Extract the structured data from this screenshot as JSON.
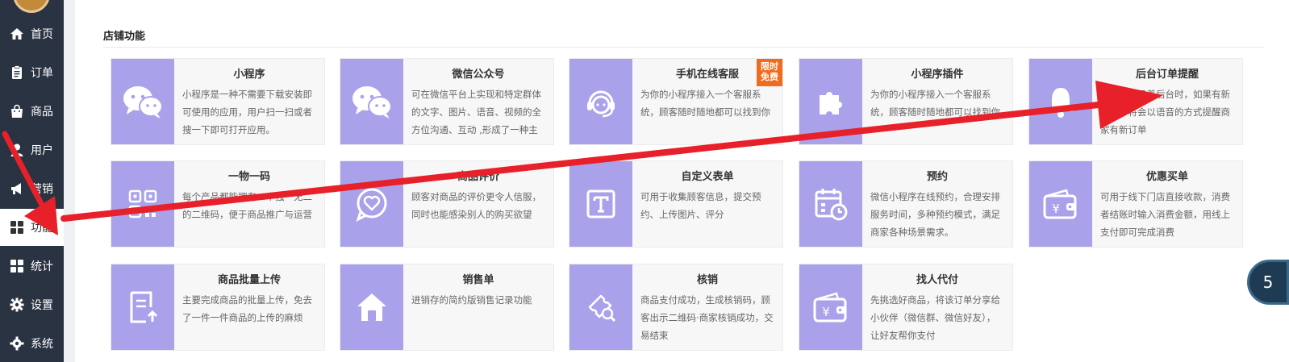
{
  "sidebar": {
    "items": [
      {
        "label": "首页",
        "icon": "home-icon"
      },
      {
        "label": "订单",
        "icon": "clipboard-icon"
      },
      {
        "label": "商品",
        "icon": "shopping-bag-icon"
      },
      {
        "label": "用户",
        "icon": "user-icon"
      },
      {
        "label": "营销",
        "icon": "megaphone-icon"
      },
      {
        "label": "功能",
        "icon": "grid-icon"
      },
      {
        "label": "统计",
        "icon": "grid-icon"
      },
      {
        "label": "设置",
        "icon": "gear-icon"
      },
      {
        "label": "系统",
        "icon": "gear-icon"
      }
    ],
    "active_label": "功能"
  },
  "section": {
    "title": "店铺功能"
  },
  "cards": [
    {
      "title": "小程序",
      "desc": "小程序是一种不需要下载安装即可使用的应用，用户扫一扫或者搜一下即可打开应用。",
      "icon": "chat-bubbles-icon"
    },
    {
      "title": "微信公众号",
      "desc": "可在微信平台上实现和特定群体的文字、图片、语音、视频的全方位沟通、互动 ,形成了一种主",
      "icon": "chat-bubbles-icon"
    },
    {
      "title": "手机在线客服",
      "desc": "为你的小程序接入一个客服系统，顾客随时随地都可以找到你",
      "icon": "headset-icon",
      "badge": "限时免费"
    },
    {
      "title": "小程序插件",
      "desc": "为你的小程序接入一个客服系统，顾客随时随地都可以找到你",
      "icon": "puzzle-icon"
    },
    {
      "title": "后台订单提醒",
      "desc": "当商家登录着后台时，如果有新订单，将会以语音的方式提醒商家有新订单",
      "icon": "bell-icon"
    },
    {
      "title": "一物一码",
      "desc": "每个产品都能拥有一个独一无二的二维码，便于商品推广与运营",
      "icon": "qrcode-icon"
    },
    {
      "title": "商品评价",
      "desc": "顾客对商品的评价更令人信服，同时也能感染别人的购买欲望",
      "icon": "heart-chat-icon"
    },
    {
      "title": "自定义表单",
      "desc": "可用于收集顾客信息，提交预约、上传图片、评分",
      "icon": "text-form-icon"
    },
    {
      "title": "预约",
      "desc": "微信小程序在线预约，合理安排服务时间，多种预约模式，满足商家各种场景需求。",
      "icon": "calendar-clock-icon"
    },
    {
      "title": "优惠买单",
      "desc": "可用于线下门店直接收款，消费者结账时输入消费金额，用线上支付即可完成消费",
      "icon": "wallet-yen-icon"
    },
    {
      "title": "商品批量上传",
      "desc": "主要完成商品的批量上传，免去了一件一件商品的上传的麻烦",
      "icon": "document-upload-icon"
    },
    {
      "title": "销售单",
      "desc": "进销存的简约版销售记录功能",
      "icon": "house-icon"
    },
    {
      "title": "核销",
      "desc": "商品支付成功，生成核销码，顾客出示二维码·商家核销成功，交易结束",
      "icon": "ticket-search-icon"
    },
    {
      "title": "找人代付",
      "desc": "先挑选好商品，将该订单分享给小伙伴（微信群、微信好友），让好友帮你支付",
      "icon": "wallet-yen-icon"
    }
  ],
  "float_button": {
    "label": "5"
  },
  "colors": {
    "sidebar_bg": "#2a3342",
    "icon_bg": "#a9a2ea",
    "badge_bg": "#f26b1d",
    "arrow": "#e8202a"
  }
}
